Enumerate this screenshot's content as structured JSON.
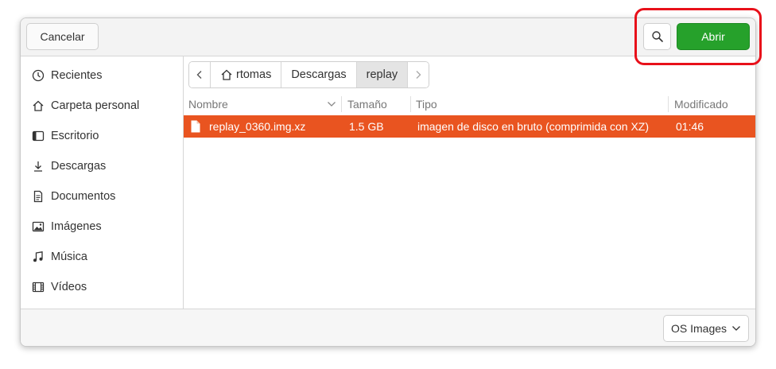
{
  "header": {
    "cancel_label": "Cancelar",
    "open_label": "Abrir"
  },
  "sidebar": {
    "items": [
      {
        "label": "Recientes",
        "icon": "clock-icon"
      },
      {
        "label": "Carpeta personal",
        "icon": "home-icon"
      },
      {
        "label": "Escritorio",
        "icon": "desktop-icon"
      },
      {
        "label": "Descargas",
        "icon": "download-icon"
      },
      {
        "label": "Documentos",
        "icon": "document-icon"
      },
      {
        "label": "Imágenes",
        "icon": "image-icon"
      },
      {
        "label": "Música",
        "icon": "music-icon"
      },
      {
        "label": "Vídeos",
        "icon": "video-icon"
      }
    ]
  },
  "pathbar": {
    "crumbs": [
      "rtomas",
      "Descargas",
      "replay"
    ]
  },
  "columns": {
    "name": "Nombre",
    "size": "Tamaño",
    "type": "Tipo",
    "modified": "Modificado"
  },
  "files": [
    {
      "name": "replay_0360.img.xz",
      "size": "1.5 GB",
      "type": "imagen de disco en bruto (comprimida con XZ)",
      "modified": "01:46"
    }
  ],
  "footer": {
    "filter_label": "OS Images"
  },
  "colors": {
    "accent_green": "#26a12b",
    "selection": "#e95420",
    "highlight_box": "#e8101a"
  }
}
